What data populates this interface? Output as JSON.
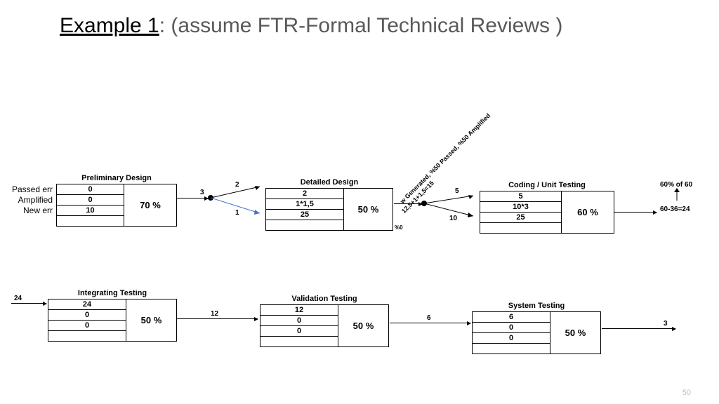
{
  "title": {
    "prefix": "Example 1",
    "rest": ": (assume FTR-Formal Technical Reviews )"
  },
  "row_labels": {
    "passed": "Passed err",
    "amplified": "Amplified",
    "new_err": "New err"
  },
  "nodes": {
    "prelim": {
      "title": "Preliminary Design",
      "rows": [
        "0",
        "0",
        "10"
      ],
      "pct": "70 %"
    },
    "detailed": {
      "title": "Detailed Design",
      "rows": [
        "2",
        "1*1,5",
        "25"
      ],
      "pct": "50 %"
    },
    "coding": {
      "title": "Coding / Unit Testing",
      "rows": [
        "5",
        "10*3",
        "25"
      ],
      "pct": "60 %"
    },
    "integ": {
      "title": "Integrating Testing",
      "rows": [
        "24",
        "0",
        "0"
      ],
      "pct": "50 %"
    },
    "valid": {
      "title": "Validation Testing",
      "rows": [
        "12",
        "0",
        "0"
      ],
      "pct": "50 %"
    },
    "system": {
      "title": "System Testing",
      "rows": [
        "6",
        "0",
        "0"
      ],
      "pct": "50 %"
    }
  },
  "edges": {
    "prelim_out": "3",
    "split_top": "2",
    "split_bot": "1",
    "detailed_top": "5",
    "detailed_bot": "10",
    "integ_in": "24",
    "integ_out": "12",
    "valid_out": "6",
    "system_out": "3"
  },
  "annotations": {
    "rot1": "w Generated, %50 Passed, %50 Amplified",
    "rot2": "12,5+1+1,5=15",
    "calc1": "60% of 60",
    "calc2": "60-36=24",
    "tiny": "%0"
  },
  "page": "50"
}
